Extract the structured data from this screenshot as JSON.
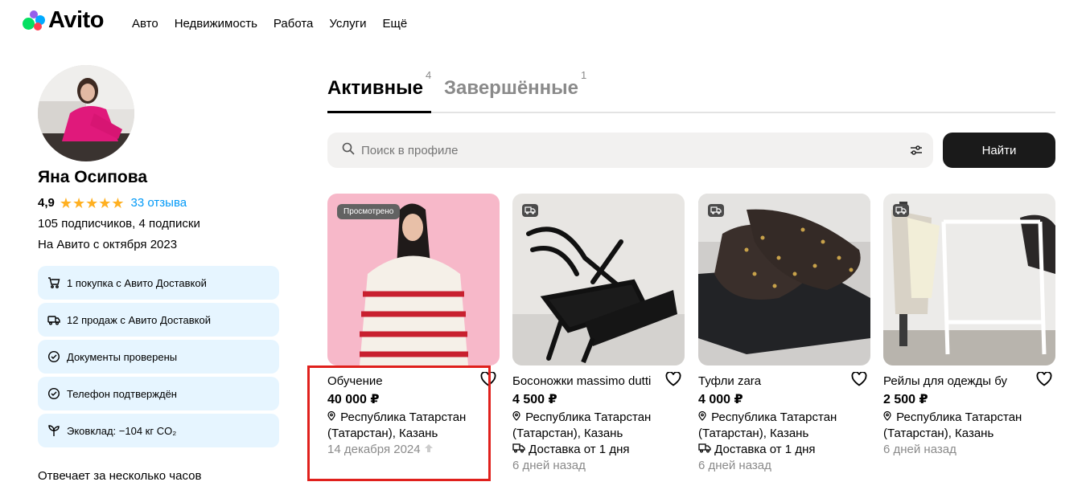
{
  "header": {
    "logo_text": "Avito",
    "nav": [
      "Авто",
      "Недвижимость",
      "Работа",
      "Услуги",
      "Ещё"
    ]
  },
  "profile": {
    "name": "Яна Осипова",
    "rating": "4,9",
    "stars": "★★★★★",
    "reviews": "33 отзыва",
    "subscribers": "105 подписчиков, 4 подписки",
    "since": "На Авито с октября 2023",
    "badges": [
      {
        "icon": "cart-icon",
        "text": "1 покупка с Авито Доставкой"
      },
      {
        "icon": "truck-icon",
        "text": "12 продаж с Авито Доставкой"
      },
      {
        "icon": "check-circle-icon",
        "text": "Документы проверены"
      },
      {
        "icon": "check-circle-icon",
        "text": "Телефон подтверждён"
      },
      {
        "icon": "plant-icon",
        "text": "Эковклад: −104 кг CO₂"
      }
    ],
    "responds": "Отвечает за несколько часов"
  },
  "tabs": {
    "active": {
      "label": "Активные",
      "count": "4"
    },
    "done": {
      "label": "Завершённые",
      "count": "1"
    }
  },
  "search": {
    "placeholder": "Поиск в профиле",
    "button": "Найти"
  },
  "cards": [
    {
      "title": "Обучение",
      "price": "40 000 ₽",
      "location": "Республика Татарстан (Татарстан), Казань",
      "delivery": "",
      "date": "14 декабря 2024",
      "badge": "Просмотрено"
    },
    {
      "title": "Босоножки massimo dutti",
      "price": "4 500 ₽",
      "location": "Республика Татарстан (Татарстан), Казань",
      "delivery": "Доставка от 1 дня",
      "date": "6 дней назад",
      "badge": ""
    },
    {
      "title": "Туфли zara",
      "price": "4 000 ₽",
      "location": "Республика Татарстан (Татарстан), Казань",
      "delivery": "Доставка от 1 дня",
      "date": "6 дней назад",
      "badge": ""
    },
    {
      "title": "Рейлы для одежды бу",
      "price": "2 500 ₽",
      "location": "Республика Татарстан (Татарстан), Казань",
      "delivery": "",
      "date": "6 дней назад",
      "badge": ""
    }
  ],
  "colors": {
    "accent_link": "#0099f7",
    "star": "#ffb021",
    "badge_bg": "#e6f5ff",
    "button_dark": "#1a1a1a",
    "highlight_box": "#e0201c"
  }
}
